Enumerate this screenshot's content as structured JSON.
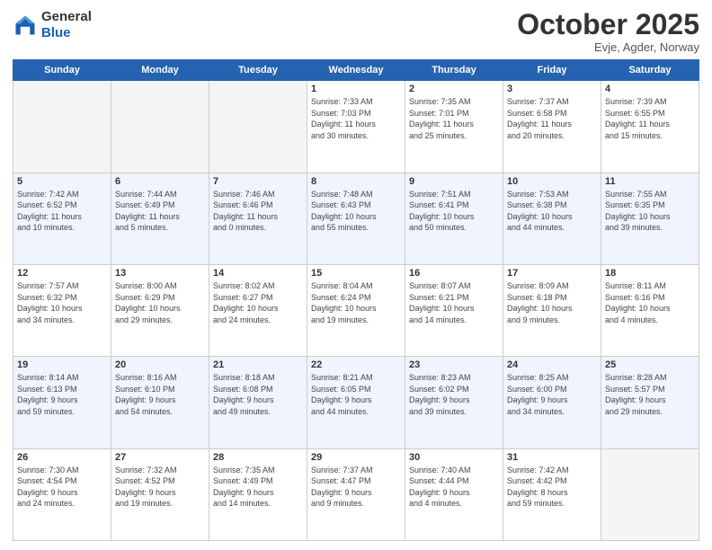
{
  "logo": {
    "general": "General",
    "blue": "Blue"
  },
  "header": {
    "month": "October 2025",
    "location": "Evje, Agder, Norway"
  },
  "days_of_week": [
    "Sunday",
    "Monday",
    "Tuesday",
    "Wednesday",
    "Thursday",
    "Friday",
    "Saturday"
  ],
  "weeks": [
    [
      {
        "day": "",
        "info": ""
      },
      {
        "day": "",
        "info": ""
      },
      {
        "day": "",
        "info": ""
      },
      {
        "day": "1",
        "info": "Sunrise: 7:33 AM\nSunset: 7:03 PM\nDaylight: 11 hours\nand 30 minutes."
      },
      {
        "day": "2",
        "info": "Sunrise: 7:35 AM\nSunset: 7:01 PM\nDaylight: 11 hours\nand 25 minutes."
      },
      {
        "day": "3",
        "info": "Sunrise: 7:37 AM\nSunset: 6:58 PM\nDaylight: 11 hours\nand 20 minutes."
      },
      {
        "day": "4",
        "info": "Sunrise: 7:39 AM\nSunset: 6:55 PM\nDaylight: 11 hours\nand 15 minutes."
      }
    ],
    [
      {
        "day": "5",
        "info": "Sunrise: 7:42 AM\nSunset: 6:52 PM\nDaylight: 11 hours\nand 10 minutes."
      },
      {
        "day": "6",
        "info": "Sunrise: 7:44 AM\nSunset: 6:49 PM\nDaylight: 11 hours\nand 5 minutes."
      },
      {
        "day": "7",
        "info": "Sunrise: 7:46 AM\nSunset: 6:46 PM\nDaylight: 11 hours\nand 0 minutes."
      },
      {
        "day": "8",
        "info": "Sunrise: 7:48 AM\nSunset: 6:43 PM\nDaylight: 10 hours\nand 55 minutes."
      },
      {
        "day": "9",
        "info": "Sunrise: 7:51 AM\nSunset: 6:41 PM\nDaylight: 10 hours\nand 50 minutes."
      },
      {
        "day": "10",
        "info": "Sunrise: 7:53 AM\nSunset: 6:38 PM\nDaylight: 10 hours\nand 44 minutes."
      },
      {
        "day": "11",
        "info": "Sunrise: 7:55 AM\nSunset: 6:35 PM\nDaylight: 10 hours\nand 39 minutes."
      }
    ],
    [
      {
        "day": "12",
        "info": "Sunrise: 7:57 AM\nSunset: 6:32 PM\nDaylight: 10 hours\nand 34 minutes."
      },
      {
        "day": "13",
        "info": "Sunrise: 8:00 AM\nSunset: 6:29 PM\nDaylight: 10 hours\nand 29 minutes."
      },
      {
        "day": "14",
        "info": "Sunrise: 8:02 AM\nSunset: 6:27 PM\nDaylight: 10 hours\nand 24 minutes."
      },
      {
        "day": "15",
        "info": "Sunrise: 8:04 AM\nSunset: 6:24 PM\nDaylight: 10 hours\nand 19 minutes."
      },
      {
        "day": "16",
        "info": "Sunrise: 8:07 AM\nSunset: 6:21 PM\nDaylight: 10 hours\nand 14 minutes."
      },
      {
        "day": "17",
        "info": "Sunrise: 8:09 AM\nSunset: 6:18 PM\nDaylight: 10 hours\nand 9 minutes."
      },
      {
        "day": "18",
        "info": "Sunrise: 8:11 AM\nSunset: 6:16 PM\nDaylight: 10 hours\nand 4 minutes."
      }
    ],
    [
      {
        "day": "19",
        "info": "Sunrise: 8:14 AM\nSunset: 6:13 PM\nDaylight: 9 hours\nand 59 minutes."
      },
      {
        "day": "20",
        "info": "Sunrise: 8:16 AM\nSunset: 6:10 PM\nDaylight: 9 hours\nand 54 minutes."
      },
      {
        "day": "21",
        "info": "Sunrise: 8:18 AM\nSunset: 6:08 PM\nDaylight: 9 hours\nand 49 minutes."
      },
      {
        "day": "22",
        "info": "Sunrise: 8:21 AM\nSunset: 6:05 PM\nDaylight: 9 hours\nand 44 minutes."
      },
      {
        "day": "23",
        "info": "Sunrise: 8:23 AM\nSunset: 6:02 PM\nDaylight: 9 hours\nand 39 minutes."
      },
      {
        "day": "24",
        "info": "Sunrise: 8:25 AM\nSunset: 6:00 PM\nDaylight: 9 hours\nand 34 minutes."
      },
      {
        "day": "25",
        "info": "Sunrise: 8:28 AM\nSunset: 5:57 PM\nDaylight: 9 hours\nand 29 minutes."
      }
    ],
    [
      {
        "day": "26",
        "info": "Sunrise: 7:30 AM\nSunset: 4:54 PM\nDaylight: 9 hours\nand 24 minutes."
      },
      {
        "day": "27",
        "info": "Sunrise: 7:32 AM\nSunset: 4:52 PM\nDaylight: 9 hours\nand 19 minutes."
      },
      {
        "day": "28",
        "info": "Sunrise: 7:35 AM\nSunset: 4:49 PM\nDaylight: 9 hours\nand 14 minutes."
      },
      {
        "day": "29",
        "info": "Sunrise: 7:37 AM\nSunset: 4:47 PM\nDaylight: 9 hours\nand 9 minutes."
      },
      {
        "day": "30",
        "info": "Sunrise: 7:40 AM\nSunset: 4:44 PM\nDaylight: 9 hours\nand 4 minutes."
      },
      {
        "day": "31",
        "info": "Sunrise: 7:42 AM\nSunset: 4:42 PM\nDaylight: 8 hours\nand 59 minutes."
      },
      {
        "day": "",
        "info": ""
      }
    ]
  ]
}
